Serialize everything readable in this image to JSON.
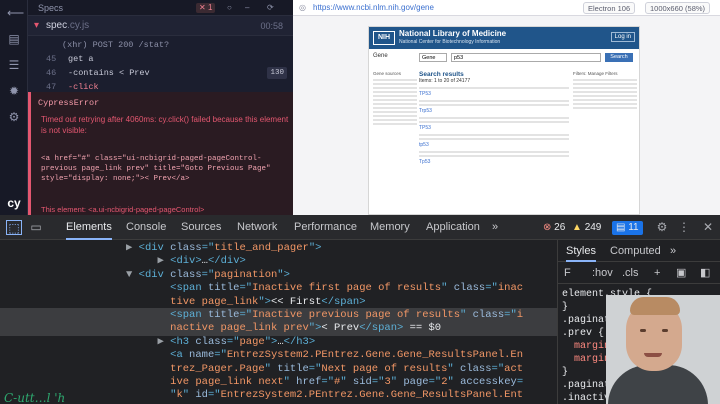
{
  "cypress": {
    "header_title": "Specs",
    "badge_fail": "1",
    "badge_pass": "",
    "spec_name": "spec",
    "spec_ext": ".cy.js",
    "duration": "00:58",
    "lines": [
      {
        "n": "",
        "text": "(xhr)  POST 200 /stat?"
      },
      {
        "n": "45",
        "text": "get  a"
      },
      {
        "n": "46",
        "text": "-contains  < Prev"
      },
      {
        "n": "47",
        "text": "-click"
      }
    ],
    "counter": "130",
    "error_name": "CypressError",
    "error_message": "Timed out retrying after 4060ms: cy.click() failed because this element is not visible:",
    "error_code": "<a href=\"#\" class=\"ui-ncbigrid-paged-pageControl-previous page_link prev\" title=\"Goto Previous Page\" style=\"display: none;\">< Prev</a>",
    "error_footer": "This element: <a.ui-ncbigrid-paged-pageControl>"
  },
  "browser": {
    "url": "https://www.ncbi.nlm.nih.gov/gene",
    "engine": "Electron 106",
    "viewport": "1000x660 (58%)",
    "ncbi_title": "National Library of Medicine",
    "ncbi_subtitle": "National Center for Biotechnology Information",
    "login": "Log in",
    "db_label": "Gene",
    "db_select": "Gene",
    "query": "p53",
    "search_btn": "Search",
    "results_title": "Search results",
    "results_count": "Items: 1 to 20 of 24177",
    "rows": [
      "TP53",
      "Trp53",
      "TP53",
      "tp53",
      "Tp53"
    ],
    "left_head": "Gene sources",
    "right_head": "Filters: Manage Filters"
  },
  "devtools": {
    "tabs": [
      "Elements",
      "Console",
      "Sources",
      "Network",
      "Performance",
      "Memory",
      "Application"
    ],
    "more": "»",
    "errors": "26",
    "warnings": "249",
    "issues": "11",
    "dom_lines": [
      {
        "indent": 4,
        "arrow": "▶",
        "parts": [
          [
            "tag",
            "<div "
          ],
          [
            "attr",
            "class"
          ],
          [
            "tag",
            "=\""
          ],
          [
            "val",
            "title_and_pager"
          ],
          [
            "tag",
            "\">"
          ]
        ]
      },
      {
        "indent": 5,
        "arrow": "▶",
        "parts": [
          [
            "tag",
            "<div>"
          ],
          [
            "txt",
            "…"
          ],
          [
            "tag",
            "</div>"
          ]
        ]
      },
      {
        "indent": 4,
        "arrow": "▼",
        "parts": [
          [
            "tag",
            "<div "
          ],
          [
            "attr",
            "class"
          ],
          [
            "tag",
            "=\""
          ],
          [
            "val",
            "pagination"
          ],
          [
            "tag",
            "\">"
          ]
        ]
      },
      {
        "indent": 5,
        "arrow": "",
        "parts": [
          [
            "tag",
            "<span "
          ],
          [
            "attr",
            "title"
          ],
          [
            "tag",
            "=\""
          ],
          [
            "val",
            "Inactive first page of results"
          ],
          [
            "tag",
            "\" "
          ],
          [
            "attr",
            "class"
          ],
          [
            "tag",
            "=\""
          ],
          [
            "val",
            "inac"
          ]
        ]
      },
      {
        "indent": 5,
        "arrow": "",
        "parts": [
          [
            "val",
            "tive page_link"
          ],
          [
            "tag",
            "\">"
          ],
          [
            "txt",
            "<< First"
          ],
          [
            "tag",
            "</span>"
          ]
        ]
      },
      {
        "indent": 5,
        "arrow": "",
        "parts": [
          [
            "tag",
            "<span "
          ],
          [
            "attr",
            "title"
          ],
          [
            "tag",
            "=\""
          ],
          [
            "val",
            "Inactive previous page of results"
          ],
          [
            "tag",
            "\" "
          ],
          [
            "attr",
            "class"
          ],
          [
            "tag",
            "=\""
          ],
          [
            "val",
            "i"
          ]
        ]
      },
      {
        "indent": 5,
        "arrow": "",
        "parts": [
          [
            "val",
            "nactive page_link prev"
          ],
          [
            "tag",
            "\">"
          ],
          [
            "txt",
            "< Prev"
          ],
          [
            "tag",
            "</span>"
          ],
          [
            "txt",
            " == $0"
          ]
        ]
      },
      {
        "indent": 5,
        "arrow": "▶",
        "parts": [
          [
            "tag",
            "<h3 "
          ],
          [
            "attr",
            "class"
          ],
          [
            "tag",
            "=\""
          ],
          [
            "val",
            "page"
          ],
          [
            "tag",
            "\">"
          ],
          [
            "txt",
            "…"
          ],
          [
            "tag",
            "</h3>"
          ]
        ]
      },
      {
        "indent": 5,
        "arrow": "",
        "parts": [
          [
            "tag",
            "<a "
          ],
          [
            "attr",
            "name"
          ],
          [
            "tag",
            "=\""
          ],
          [
            "val",
            "EntrezSystem2.PEntrez.Gene.Gene_ResultsPanel.En"
          ]
        ]
      },
      {
        "indent": 5,
        "arrow": "",
        "parts": [
          [
            "val",
            "trez_Pager.Page"
          ],
          [
            "tag",
            "\" "
          ],
          [
            "attr",
            "title"
          ],
          [
            "tag",
            "=\""
          ],
          [
            "val",
            "Next page of results"
          ],
          [
            "tag",
            "\" "
          ],
          [
            "attr",
            "class"
          ],
          [
            "tag",
            "=\""
          ],
          [
            "val",
            "act"
          ]
        ]
      },
      {
        "indent": 5,
        "arrow": "",
        "parts": [
          [
            "val",
            "ive page_link next"
          ],
          [
            "tag",
            "\" "
          ],
          [
            "attr",
            "href"
          ],
          [
            "tag",
            "=\""
          ],
          [
            "val",
            "#"
          ],
          [
            "tag",
            "\" "
          ],
          [
            "attr",
            "sid"
          ],
          [
            "tag",
            "=\""
          ],
          [
            "val",
            "3"
          ],
          [
            "tag",
            "\" "
          ],
          [
            "attr",
            "page"
          ],
          [
            "tag",
            "=\""
          ],
          [
            "val",
            "2"
          ],
          [
            "tag",
            "\" "
          ],
          [
            "attr",
            "accesskey"
          ],
          [
            "tag",
            "="
          ]
        ]
      },
      {
        "indent": 5,
        "arrow": "",
        "parts": [
          [
            "tag",
            "\""
          ],
          [
            "val",
            "k"
          ],
          [
            "tag",
            "\" "
          ],
          [
            "attr",
            "id"
          ],
          [
            "tag",
            "=\""
          ],
          [
            "val",
            "EntrezSystem2.PEntrez.Gene.Gene_ResultsPanel.Ent"
          ]
        ]
      }
    ],
    "styles": {
      "tabs": [
        "Styles",
        "Computed"
      ],
      "more": "»",
      "filter": "F",
      "hov": ":hov",
      "cls": ".cls",
      "lines": [
        [
          [
            "sel2",
            "element.style {"
          ]
        ],
        [
          [
            "sel2",
            "}"
          ]
        ],
        [
          [
            "sel2",
            ".pagination"
          ],
          [
            "link2",
            " :477"
          ]
        ],
        [
          [
            "sel2",
            ".prev {"
          ]
        ],
        [
          [
            "prop",
            "  margin-r"
          ]
        ],
        [
          [
            "prop",
            "  margin-l"
          ]
        ],
        [
          [
            "sel2",
            "}"
          ]
        ],
        [
          [
            "sel2",
            ".pagination"
          ],
          [
            "link2",
            " :477"
          ]
        ],
        [
          [
            "sel2",
            ".inactive"
          ]
        ]
      ]
    }
  },
  "watermark": "C-utt…l 'h"
}
